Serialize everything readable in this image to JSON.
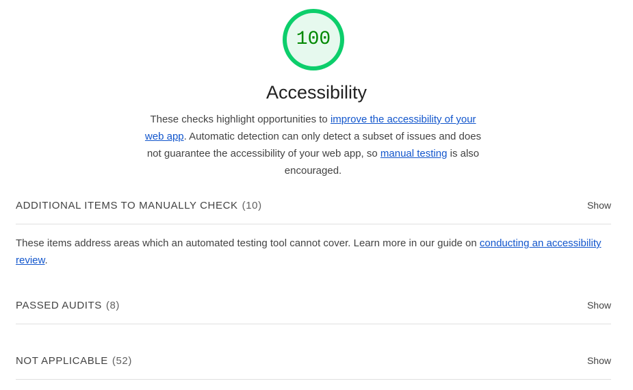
{
  "score": {
    "value": "100",
    "fraction": 1.0,
    "ring_color": "#0cce6b",
    "fill_color": "#e6f9ee",
    "text_color": "#008800"
  },
  "category": {
    "title": "Accessibility",
    "description": {
      "part1": "These checks highlight opportunities to ",
      "link1": "improve the accessibility of your web app",
      "part2": ". Automatic detection can only detect a subset of issues and does not guarantee the accessibility of your web app, so ",
      "link2": "manual testing",
      "part3": " is also encouraged."
    }
  },
  "groups": [
    {
      "title": "ADDITIONAL ITEMS TO MANUALLY CHECK",
      "count": "(10)",
      "toggle": "Show",
      "description": {
        "part1": "These items address areas which an automated testing tool cannot cover. Learn more in our guide on ",
        "link": "conducting an accessibility review",
        "part2": "."
      }
    },
    {
      "title": "PASSED AUDITS",
      "count": "(8)",
      "toggle": "Show"
    },
    {
      "title": "NOT APPLICABLE",
      "count": "(52)",
      "toggle": "Show"
    }
  ],
  "colors": {
    "link": "#1155cc",
    "divider": "#e0e0e0"
  }
}
